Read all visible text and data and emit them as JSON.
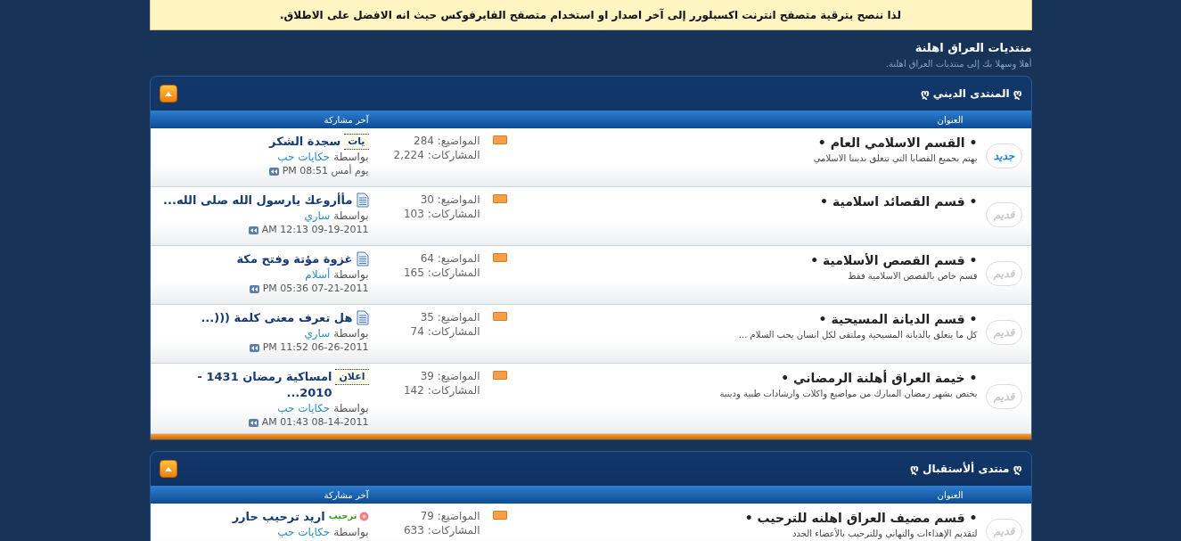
{
  "notice": {
    "text": "لذا ننصح بترقية متصفح **انترنت اكسبلورر** إلى آخر اصدار او استخدام متصفح **الفايرفوكس** حيث انه الافضل على الاطلاق."
  },
  "forum": {
    "title": "منتديات العراق اهلنة",
    "subtitle": "أهلا وسهلا بك إلى منتديات العراق اهلنة."
  },
  "sections": [
    {
      "title": "ღ المنتدى الديني ღ",
      "expanded": true,
      "columns": [
        "العنوان",
        "آخر مشاركة"
      ],
      "rows": [
        {
          "status": "جديد",
          "new": true,
          "title": "• القسم الاسلامي العام •",
          "description": "يهتم بجميع القضايا التي تتعلق بديننا الاسلامي",
          "topics": "المواضيع: 284",
          "posts": "المشاركات: 2,224",
          "last_post": {
            "prefix": {
              "kind": "tag",
              "text": "يات"
            },
            "title": "سجدة الشكر",
            "by": "بواسطة",
            "user": "حكايات حب",
            "time": "يوم أمس 08:51 PM"
          }
        },
        {
          "status": "قديم",
          "new": false,
          "title": "• قسم القصائد اسلامية •",
          "topics": "المواضيع: 30",
          "posts": "المشاركات: 103",
          "last_post": {
            "prefix": {
              "kind": "doc"
            },
            "title": "مأأروعك يارسول الله صلى الله...",
            "by": "بواسطة",
            "user": "ساري",
            "time": "09-19-2011 12:13 AM"
          }
        },
        {
          "status": "قديم",
          "new": false,
          "title": "• قسم القصص الأسلامية •",
          "description": "قسم خاص بالقصص الاسلامية فقط",
          "topics": "المواضيع: 64",
          "posts": "المشاركات: 165",
          "last_post": {
            "prefix": {
              "kind": "doc"
            },
            "title": "غزوة مؤتة وفتح مكة",
            "by": "بواسطة",
            "user": "أسلام",
            "time": "07-21-2011 05:36 PM"
          }
        },
        {
          "status": "قديم",
          "new": false,
          "title": "• قسم الديانة المسيحية •",
          "description": "كل ما يتعلق بالديانة المسيحية وملتقى لكل انسان يحب السلام ...",
          "topics": "المواضيع: 35",
          "posts": "المشاركات: 74",
          "last_post": {
            "prefix": {
              "kind": "doc"
            },
            "title": "هل تعرف معنى كلمة (((...",
            "by": "بواسطة",
            "user": "ساري",
            "time": "06-26-2011 11:52 PM"
          }
        },
        {
          "status": "قديم",
          "new": false,
          "title": "• خيمة العراق أهلنة الرمضاني •",
          "description": "يختص بشهر رمضان المبارك من مواضيع واكلات وارشادات طبية ودينية",
          "topics": "المواضيع: 39",
          "posts": "المشاركات: 142",
          "last_post": {
            "prefix": {
              "kind": "tag",
              "text": "اعلان"
            },
            "title": "امساكية رمضان 1431 - 2010...",
            "by": "بواسطة",
            "user": "حكايات حب",
            "time": "08-14-2011 01:43 AM"
          }
        }
      ]
    },
    {
      "title": "ღ منتدى ألأستقبال ღ",
      "expanded": true,
      "columns": [
        "العنوان",
        "آخر مشاركة"
      ],
      "rows": [
        {
          "status": "قديم",
          "new": false,
          "title": "• قسم مضيف العراق اهلنه للترحيب •",
          "description": "لتقديم الإهداءات والتهاني وللترحيب بالأعضاء الجدد",
          "topics": "المواضيع: 79",
          "posts": "المشاركات: 633",
          "last_post": {
            "prefix": {
              "kind": "welcome",
              "text": "ترحيب"
            },
            "title": "اريد ترحيب حارر",
            "by": "بواسطة",
            "user": "حكايات حب"
          }
        }
      ]
    }
  ]
}
